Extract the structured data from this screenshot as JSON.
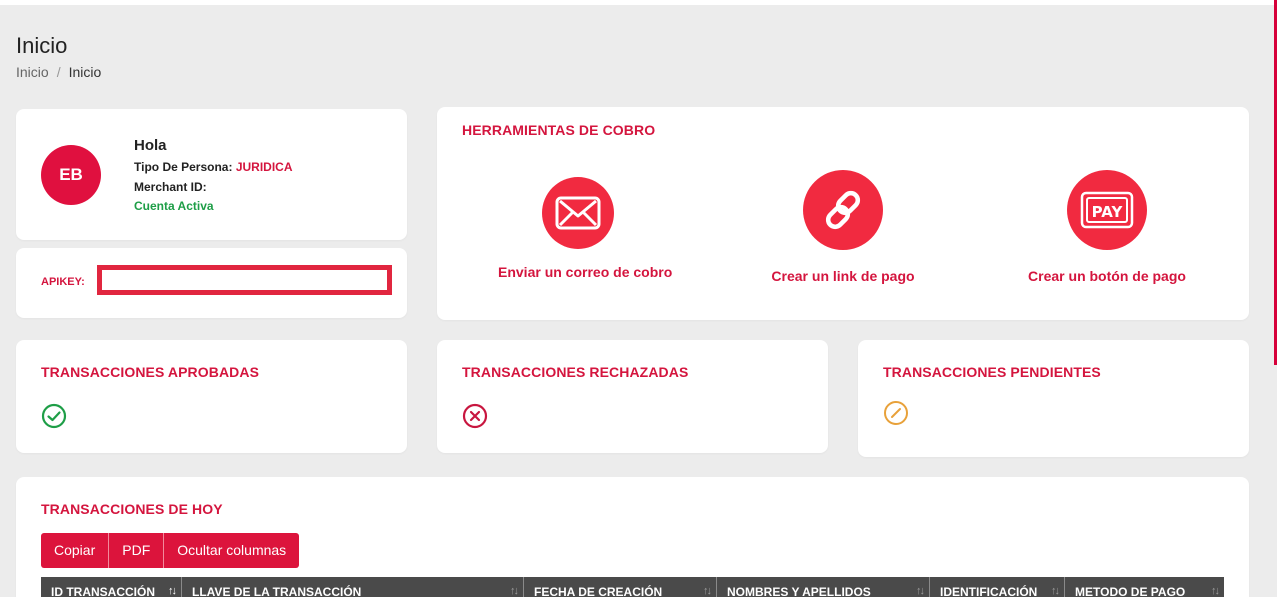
{
  "page": {
    "title": "Inicio",
    "breadcrumb": [
      "Inicio",
      "Inicio"
    ]
  },
  "profile": {
    "avatar_initials": "EB",
    "greeting": "Hola",
    "person_type_label": "Tipo De Persona:",
    "person_type_value": "JURIDICA",
    "merchant_id_label": "Merchant ID:",
    "merchant_id_value": "",
    "status": "Cuenta Activa"
  },
  "apikey": {
    "label": "APIKEY:",
    "value": ""
  },
  "tools": {
    "title": "HERRAMIENTAS DE COBRO",
    "items": [
      {
        "label": "Enviar un correo de cobro",
        "icon": "envelope-icon"
      },
      {
        "label": "Crear un link de pago",
        "icon": "link-chain-icon"
      },
      {
        "label": "Crear un botón de pago",
        "icon": "pay-button-icon"
      }
    ]
  },
  "stats": {
    "approved": {
      "title": "TRANSACCIONES APROBADAS",
      "icon": "check-circle-icon"
    },
    "rejected": {
      "title": "TRANSACCIONES RECHAZADAS",
      "icon": "x-circle-icon"
    },
    "pending": {
      "title": "TRANSACCIONES PENDIENTES",
      "icon": "slash-circle-icon"
    }
  },
  "today": {
    "title": "TRANSACCIONES DE HOY",
    "buttons": [
      "Copiar",
      "PDF",
      "Ocultar columnas"
    ],
    "columns": [
      "ID TRANSACCIÓN",
      "LLAVE DE LA TRANSACCIÓN",
      "FECHA DE CREACIÓN",
      "NOMBRES Y APELLIDOS",
      "IDENTIFICACIÓN",
      "METODO DE PAGO"
    ]
  },
  "colors": {
    "accent": "#d4153e",
    "tool_circle": "#f12a40",
    "success": "#1e9e47",
    "warning": "#e8a13a",
    "table_header": "#4a4a4a"
  }
}
